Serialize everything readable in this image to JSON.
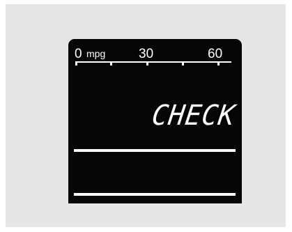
{
  "gauge": {
    "scale_min": "0",
    "unit": "mpg",
    "scale_mid": "30",
    "scale_max": "60"
  },
  "display": {
    "message": "CHECK"
  },
  "colors": {
    "panel_background": "#e6e6e6",
    "display_background": "#060606",
    "segment_color": "#ffffff"
  }
}
